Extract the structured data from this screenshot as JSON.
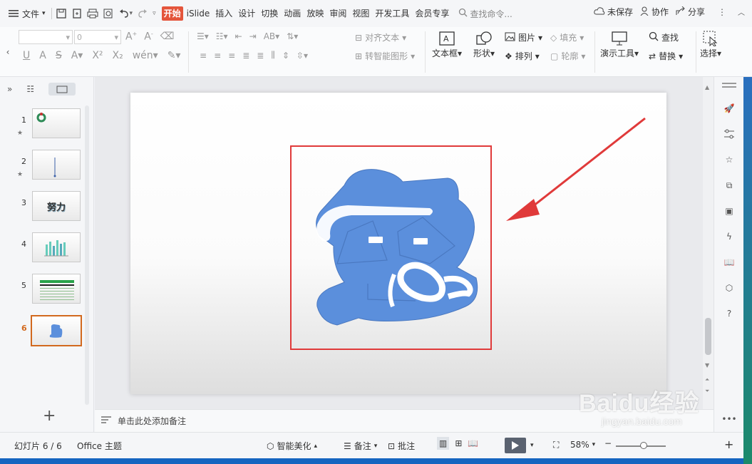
{
  "menubar": {
    "file_label": "文件",
    "tabs": [
      "开始",
      "iSlide",
      "插入",
      "设计",
      "切换",
      "动画",
      "放映",
      "审阅",
      "视图",
      "开发工具",
      "会员专享"
    ],
    "search_placeholder": "查找命令...",
    "unsaved": "未保存",
    "collab": "协作",
    "share": "分享"
  },
  "ribbon": {
    "font_size": "0",
    "align_text": "对齐文本",
    "smart_shape": "转智能图形",
    "picture": "图片",
    "fill": "填充",
    "arrange": "排列",
    "outline": "轮廓",
    "textbox": "文本框",
    "shape": "形状",
    "presenter": "演示工具",
    "find": "查找",
    "replace": "替换",
    "select": "选择"
  },
  "slides": [
    {
      "num": "1"
    },
    {
      "num": "2"
    },
    {
      "num": "3"
    },
    {
      "num": "4"
    },
    {
      "num": "5"
    },
    {
      "num": "6"
    }
  ],
  "thumb3_text": "努力",
  "notes_placeholder": "单击此处添加备注",
  "status": {
    "slide_count": "幻灯片 6 / 6",
    "theme": "Office 主题",
    "beautify": "智能美化",
    "notes": "备注",
    "comment": "批注",
    "zoom": "58%"
  },
  "colors": {
    "accent": "#e4553b",
    "shape_fill": "#5b8fdc",
    "redbox": "#e03a3a"
  },
  "watermark": {
    "line1": "Baidu经验",
    "line2": "jingyan.baidu.com"
  }
}
